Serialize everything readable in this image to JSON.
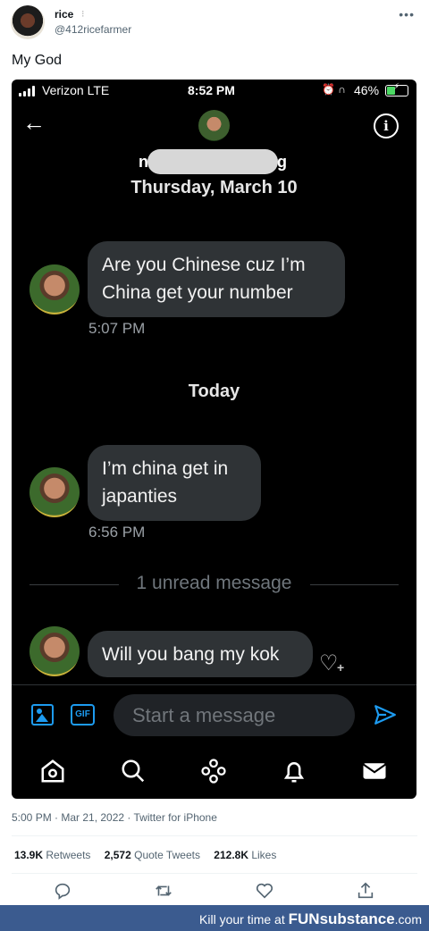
{
  "tweet": {
    "display_name": "rice",
    "name_mark": "⁝",
    "handle": "@412ricefarmer",
    "text": "My God",
    "meta": "5:00 PM · Mar 21, 2022 · Twitter for iPhone",
    "stats": [
      {
        "value": "13.9K",
        "label": "Retweets"
      },
      {
        "value": "2,572",
        "label": "Quote Tweets"
      },
      {
        "value": "212.8K",
        "label": "Likes"
      }
    ],
    "actions": [
      "reply-icon",
      "retweet-icon",
      "like-icon",
      "share-icon"
    ]
  },
  "phone": {
    "status_bar": {
      "carrier": "Verizon  LTE",
      "time": "8:52 PM",
      "battery": "46%",
      "battery_level": 0.46
    },
    "conversation": {
      "contact_first": "n",
      "contact_last": "g",
      "date_header": "Thursday, March 10",
      "today_label": "Today",
      "unread_label": "1 unread message"
    },
    "messages": [
      {
        "text": "Are you Chinese cuz I’m China get your number",
        "line1": "Are you Chinese cuz I’m",
        "line2": "China get your number",
        "time": "5:07 PM"
      },
      {
        "text": "I’m china get in japanties",
        "line1": "I’m china get in",
        "line2": "japanties",
        "time": "6:56 PM"
      },
      {
        "text": "Will you bang my kok",
        "line1": "Will you bang my kok",
        "time": ""
      }
    ],
    "composer": {
      "placeholder": "Start a message",
      "gif_label": "GIF"
    },
    "accent_color": "#1d9bf0"
  },
  "banner": {
    "prefix": "Kill your time at ",
    "brand_bold": "FUN",
    "brand_rest": "substance",
    "suffix": ".com"
  }
}
